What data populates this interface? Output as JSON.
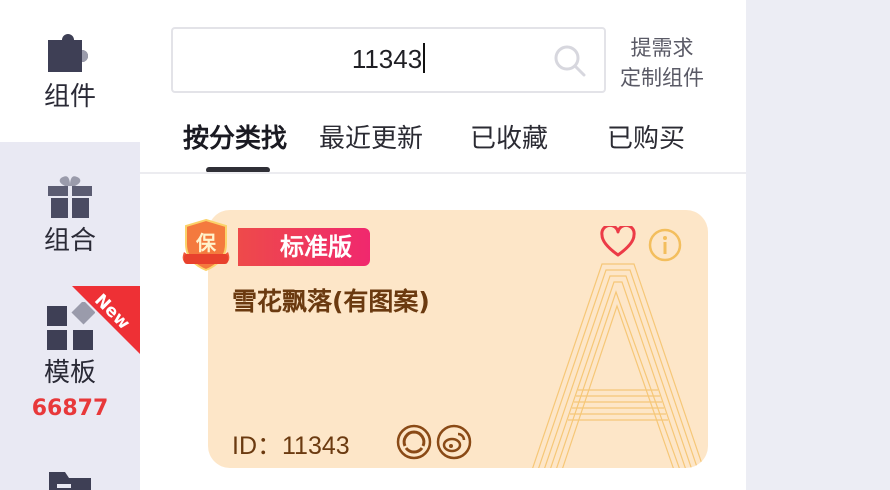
{
  "sidebar": {
    "items": [
      {
        "label": "组件",
        "icon": "puzzle-icon"
      },
      {
        "label": "组合",
        "icon": "gift-icon"
      },
      {
        "label": "模板",
        "icon": "template-icon",
        "count": "66877",
        "badge": "New"
      },
      {
        "label": "",
        "icon": "folder-icon"
      }
    ]
  },
  "search": {
    "value": "11343"
  },
  "custom_request": {
    "line1": "提需求",
    "line2": "定制组件"
  },
  "tabs": [
    {
      "label": "按分类找",
      "active": true
    },
    {
      "label": "最近更新",
      "active": false
    },
    {
      "label": "已收藏",
      "active": false
    },
    {
      "label": "已购买",
      "active": false
    }
  ],
  "card": {
    "badge": "标准版",
    "title": "雪花飘落(有图案)",
    "id_text": "ID：11343",
    "guarantee_glyph": "保",
    "background_color": "#fde6c8",
    "accent_color": "#ee4a4a"
  }
}
